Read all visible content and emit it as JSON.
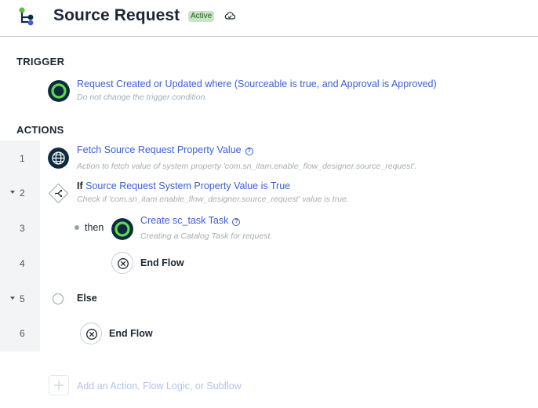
{
  "header": {
    "title": "Source Request",
    "status": "Active",
    "logo_icon": "flow-tree-icon",
    "cloud_icon": "cloud-icon"
  },
  "trigger": {
    "section_label": "TRIGGER",
    "title_main": "Request Created or Updated",
    "title_where": "where",
    "title_condition": "(Sourceable is true, and Approval is Approved)",
    "subtitle": "Do not change the trigger condition."
  },
  "actions": {
    "section_label": "ACTIONS",
    "rows": [
      {
        "num": "1",
        "title": "Fetch Source Request Property Value",
        "help": "?",
        "subtitle": "Action to fetch value of system property 'com.sn_itam.enable_flow_designer.source_request'."
      },
      {
        "num": "2",
        "keyword": "If",
        "title": "Source Request System Property Value is True",
        "subtitle": "Check if  'com.sn_itam.enable_flow_designer.source_request' value is true."
      },
      {
        "num": "3",
        "then_label": "then",
        "title": "Create sc_task Task",
        "help": "?",
        "subtitle": "Creating a Catalog Task for request."
      },
      {
        "num": "4",
        "label": "End Flow"
      },
      {
        "num": "5",
        "label": "Else"
      },
      {
        "num": "6",
        "label": "End Flow"
      }
    ],
    "add_label": "Add an Action, Flow Logic, or Subflow"
  },
  "colors": {
    "accent": "#3b5fd9",
    "badge_bg": "#c9e5c5",
    "badge_text": "#1f5a1d",
    "gutter": "#f3f4f5",
    "icon_dark": "#0d2b3e",
    "icon_green": "#62d84e"
  }
}
